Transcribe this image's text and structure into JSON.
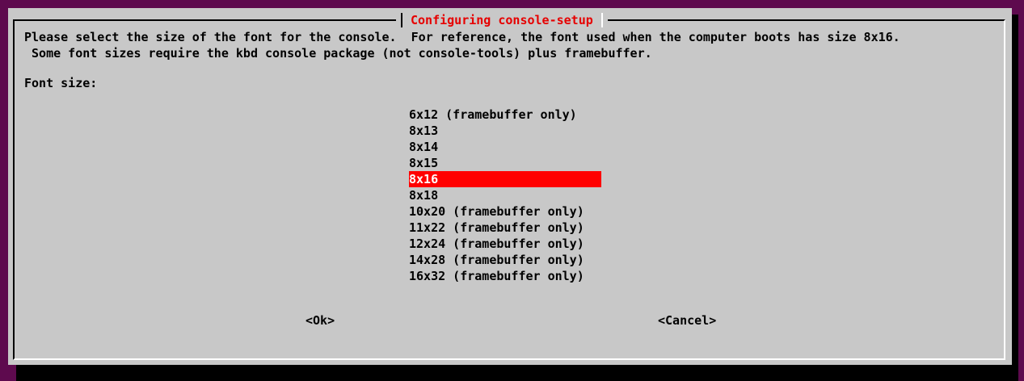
{
  "dialog": {
    "title": "Configuring console-setup",
    "message_line1": "Please select the size of the font for the console.  For reference, the font used when the computer boots has size 8x16.",
    "message_line2": " Some font sizes require the kbd console package (not console-tools) plus framebuffer.",
    "prompt_label": "Font size:",
    "options": [
      "6x12 (framebuffer only)",
      "8x13",
      "8x14",
      "8x15",
      "8x16",
      "8x18",
      "10x20 (framebuffer only)",
      "11x22 (framebuffer only)",
      "12x24 (framebuffer only)",
      "14x28 (framebuffer only)",
      "16x32 (framebuffer only)"
    ],
    "selected_option": "8x16",
    "ok_button": "<Ok>",
    "cancel_button": "<Cancel>"
  },
  "colors": {
    "background": "#5e0a4e",
    "dialog": "#c8c8c8",
    "title": "#e60000",
    "highlight": "#ff0000"
  }
}
